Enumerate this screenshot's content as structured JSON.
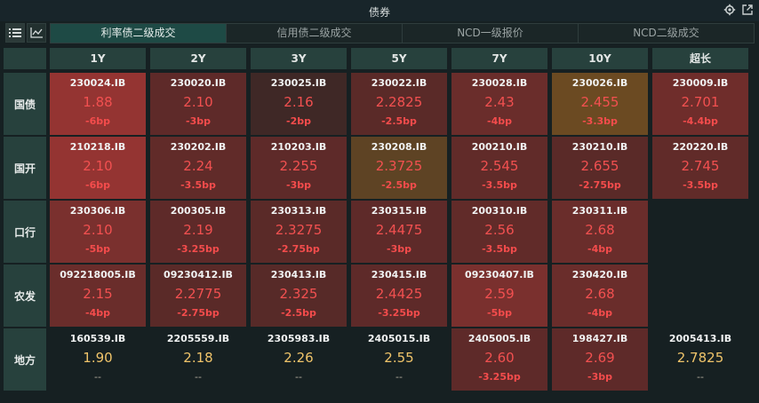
{
  "window": {
    "title": "债券",
    "icons": [
      "gear-icon",
      "popout-icon"
    ]
  },
  "view_buttons": [
    {
      "name": "list-view-icon",
      "active": true
    },
    {
      "name": "chart-view-icon",
      "active": false
    }
  ],
  "tabs": [
    {
      "label": "利率债二级成交",
      "active": true
    },
    {
      "label": "信用债二级成交",
      "active": false
    },
    {
      "label": "NCD一级报价",
      "active": false
    },
    {
      "label": "NCD二级成交",
      "active": false
    }
  ],
  "columns": [
    "1Y",
    "2Y",
    "3Y",
    "5Y",
    "7Y",
    "10Y",
    "超长"
  ],
  "rows": [
    {
      "label": "国债",
      "cells": [
        {
          "code": "230024.IB",
          "yield": "1.88",
          "change": "-6bp",
          "bg": "#943432"
        },
        {
          "code": "230020.IB",
          "yield": "2.10",
          "change": "-3bp",
          "bg": "#5e2a29"
        },
        {
          "code": "230025.IB",
          "yield": "2.16",
          "change": "-2bp",
          "bg": "#3f2826"
        },
        {
          "code": "230022.IB",
          "yield": "2.2825",
          "change": "-2.5bp",
          "bg": "#5a2a28"
        },
        {
          "code": "230028.IB",
          "yield": "2.43",
          "change": "-4bp",
          "bg": "#6a2d2b"
        },
        {
          "code": "230026.IB",
          "yield": "2.455",
          "change": "-3.3bp",
          "bg": "#6b4a22"
        },
        {
          "code": "230009.IB",
          "yield": "2.701",
          "change": "-4.4bp",
          "bg": "#6f2d2b"
        }
      ]
    },
    {
      "label": "国开",
      "cells": [
        {
          "code": "210218.IB",
          "yield": "2.10",
          "change": "-6bp",
          "bg": "#943432"
        },
        {
          "code": "230202.IB",
          "yield": "2.24",
          "change": "-3.5bp",
          "bg": "#612b29"
        },
        {
          "code": "210203.IB",
          "yield": "2.255",
          "change": "-3bp",
          "bg": "#5e2a29"
        },
        {
          "code": "230208.IB",
          "yield": "2.3725",
          "change": "-2.5bp",
          "bg": "#5e4324"
        },
        {
          "code": "200210.IB",
          "yield": "2.545",
          "change": "-3.5bp",
          "bg": "#612b29"
        },
        {
          "code": "230210.IB",
          "yield": "2.655",
          "change": "-2.75bp",
          "bg": "#5a2a28"
        },
        {
          "code": "220220.IB",
          "yield": "2.745",
          "change": "-3.5bp",
          "bg": "#612b29"
        }
      ]
    },
    {
      "label": "口行",
      "cells": [
        {
          "code": "230306.IB",
          "yield": "2.10",
          "change": "-5bp",
          "bg": "#7a302e"
        },
        {
          "code": "200305.IB",
          "yield": "2.19",
          "change": "-3.25bp",
          "bg": "#5e2a29"
        },
        {
          "code": "230313.IB",
          "yield": "2.3275",
          "change": "-2.75bp",
          "bg": "#5a2a28"
        },
        {
          "code": "230315.IB",
          "yield": "2.4475",
          "change": "-3bp",
          "bg": "#5e2a29"
        },
        {
          "code": "200310.IB",
          "yield": "2.56",
          "change": "-3.5bp",
          "bg": "#612b29"
        },
        {
          "code": "230311.IB",
          "yield": "2.68",
          "change": "-4bp",
          "bg": "#6a2d2b"
        },
        null
      ]
    },
    {
      "label": "农发",
      "cells": [
        {
          "code": "092218005.IB",
          "yield": "2.15",
          "change": "-4bp",
          "bg": "#6a2d2b"
        },
        {
          "code": "09230412.IB",
          "yield": "2.2775",
          "change": "-2.75bp",
          "bg": "#5a2a28"
        },
        {
          "code": "230413.IB",
          "yield": "2.325",
          "change": "-2.5bp",
          "bg": "#572a28"
        },
        {
          "code": "230415.IB",
          "yield": "2.4425",
          "change": "-3.25bp",
          "bg": "#5e2a29"
        },
        {
          "code": "09230407.IB",
          "yield": "2.59",
          "change": "-5bp",
          "bg": "#7a302e"
        },
        {
          "code": "230420.IB",
          "yield": "2.68",
          "change": "-4bp",
          "bg": "#6a2d2b"
        },
        null
      ]
    },
    {
      "label": "地方",
      "cells": [
        {
          "code": "160539.IB",
          "yield": "1.90",
          "change": "--",
          "bg": "",
          "neutral": true
        },
        {
          "code": "2205559.IB",
          "yield": "2.18",
          "change": "--",
          "bg": "",
          "neutral": true
        },
        {
          "code": "2305983.IB",
          "yield": "2.26",
          "change": "--",
          "bg": "",
          "neutral": true
        },
        {
          "code": "2405015.IB",
          "yield": "2.55",
          "change": "--",
          "bg": "",
          "neutral": true
        },
        {
          "code": "2405005.IB",
          "yield": "2.60",
          "change": "-3.25bp",
          "bg": "#5e2a29"
        },
        {
          "code": "198427.IB",
          "yield": "2.69",
          "change": "-3bp",
          "bg": "#5e2a29"
        },
        {
          "code": "2005413.IB",
          "yield": "2.7825",
          "change": "--",
          "bg": "",
          "neutral": true
        }
      ]
    }
  ]
}
